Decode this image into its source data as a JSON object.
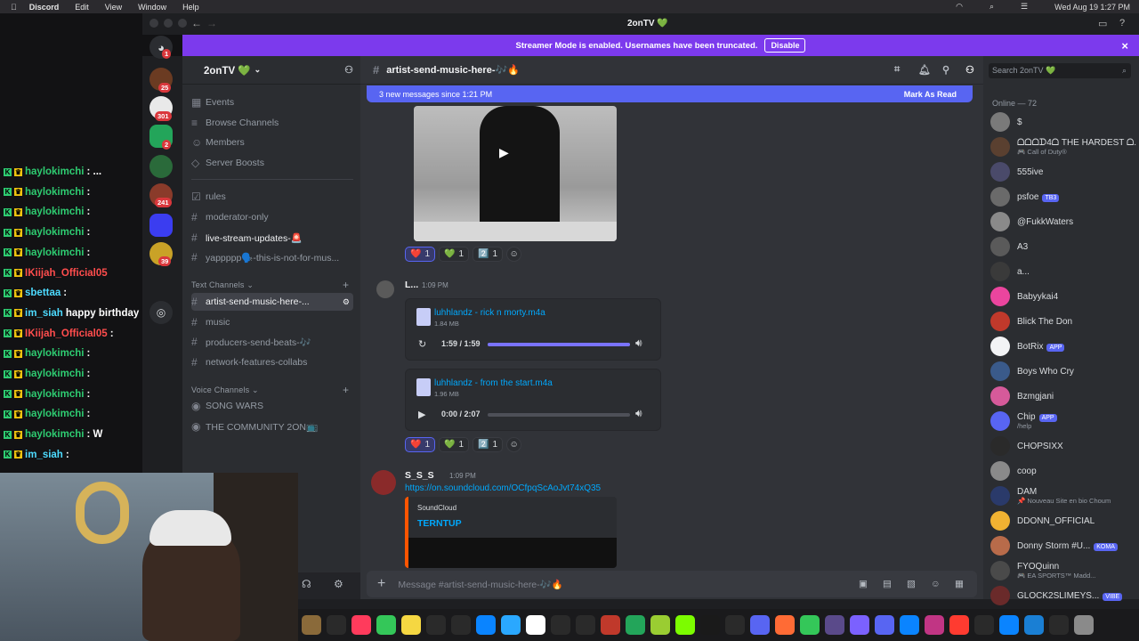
{
  "menubar": {
    "app": "Discord",
    "items": [
      "Edit",
      "View",
      "Window",
      "Help"
    ],
    "clock": "Wed Aug 19  1:27 PM"
  },
  "window": {
    "title": "2onTV 💚"
  },
  "banner": {
    "text": "Streamer Mode is enabled. Usernames have been truncated.",
    "button": "Disable"
  },
  "guild_badges": [
    "1",
    "25",
    "301",
    "2",
    "241",
    "39"
  ],
  "overlay_chat": [
    {
      "name": "haylokimchi",
      "text": ": ..."
    },
    {
      "name": "haylokimchi",
      "text": ":"
    },
    {
      "name": "haylokimchi",
      "text": ":"
    },
    {
      "name": "haylokimchi",
      "text": ":"
    },
    {
      "name": "haylokimchi",
      "text": ":"
    },
    {
      "name": "IKiijah_Official05",
      "text": ""
    },
    {
      "name": "sbettaa",
      "text": ":"
    },
    {
      "name": "im_siah",
      "text": "happy birthday"
    },
    {
      "name": "IKiijah_Official05",
      "text": ":"
    },
    {
      "name": "haylokimchi",
      "text": ":"
    },
    {
      "name": "haylokimchi",
      "text": ":"
    },
    {
      "name": "haylokimchi",
      "text": ":"
    },
    {
      "name": "haylokimchi",
      "text": ":"
    },
    {
      "name": "haylokimchi",
      "text": ": W"
    },
    {
      "name": "im_siah",
      "text": ":"
    }
  ],
  "server": {
    "name": "2onTV 💚"
  },
  "channels": {
    "top": [
      "Events",
      "Browse Channels",
      "Members",
      "Server Boosts"
    ],
    "list": [
      "rules",
      "moderator-only",
      "live-stream-updates-🚨",
      "yappppp🗣️-this-is-not-for-mus..."
    ],
    "text_category": "Text Channels",
    "text": [
      "artist-send-music-here-...",
      "music",
      "producers-send-beats-🎶",
      "network-features-collabs"
    ],
    "voice_category": "Voice Channels",
    "voice": [
      "SONG WARS",
      "THE COMMUNITY 2ON📺"
    ]
  },
  "channel_header": {
    "name": "artist-send-music-here-🎶🔥"
  },
  "new_messages": {
    "text": "3 new messages since 1:21 PM",
    "action": "Mark As Read"
  },
  "messages": [
    {
      "author": "L...",
      "time": "1:09 PM"
    },
    {
      "author": "S_S_S",
      "time": "1:09 PM",
      "link": "https://on.soundcloud.com/OCfpqScAoJvt74xQ35"
    }
  ],
  "reactions_1": [
    {
      "emoji": "❤️",
      "count": "1"
    },
    {
      "emoji": "💚",
      "count": "1"
    },
    {
      "emoji": "2️⃣",
      "count": "1"
    }
  ],
  "reactions_2": [
    {
      "emoji": "❤️",
      "count": "1"
    },
    {
      "emoji": "💚",
      "count": "1"
    },
    {
      "emoji": "2️⃣",
      "count": "1"
    }
  ],
  "attachments": [
    {
      "name": "luhhlandz - rick n morty.m4a",
      "size": "1.84 MB",
      "time": "1:59 / 1:59",
      "progress": 1.0
    },
    {
      "name": "luhhlandz - from the start.m4a",
      "size": "1.96 MB",
      "time": "0:00 / 2:07",
      "progress": 0.0
    }
  ],
  "embed": {
    "provider": "SoundCloud",
    "title": "TERNTUP"
  },
  "composer": {
    "placeholder": "Message #artist-send-music-here-🎶🔥"
  },
  "members": {
    "search": "Search 2onTV 💚",
    "online_header": "Online — 72",
    "list": [
      {
        "name": "$",
        "sub": ""
      },
      {
        "name": "ᗝᗝᗝᗪ4ᗝ THE HARDEST ᗝ...",
        "sub": "🎮 Call of Duty®"
      },
      {
        "name": "555ive",
        "sub": ""
      },
      {
        "name": "psfoe",
        "sub": "",
        "tag": "TB3"
      },
      {
        "name": "@FukkWaters",
        "sub": ""
      },
      {
        "name": "A3",
        "sub": ""
      },
      {
        "name": "a...",
        "sub": ""
      },
      {
        "name": "Babyykai4",
        "sub": ""
      },
      {
        "name": "Blick The Don",
        "sub": ""
      },
      {
        "name": "BotRix",
        "sub": "",
        "tag": "APP"
      },
      {
        "name": "Boys Who Cry",
        "sub": ""
      },
      {
        "name": "Bzmgjani",
        "sub": ""
      },
      {
        "name": "Chip",
        "sub": "/help",
        "tag": "APP"
      },
      {
        "name": "CHOPSIXX",
        "sub": ""
      },
      {
        "name": "coop",
        "sub": ""
      },
      {
        "name": "DAM",
        "sub": "📌 Nouveau Site en bio Choum"
      },
      {
        "name": "DDONN_OFFICIAL",
        "sub": ""
      },
      {
        "name": "Donny Storm #U...",
        "sub": "",
        "tag": "KOMA"
      },
      {
        "name": "FYOQuinn",
        "sub": "🎮 EA SPORTS™ Madd..."
      },
      {
        "name": "GLOCK2SLIMEYS...",
        "sub": "",
        "tag": "VIBE"
      }
    ]
  },
  "colors": {
    "accent": "#5865f2",
    "banner": "#7c3aed",
    "link": "#00a8fc",
    "online": "#23a55a"
  }
}
